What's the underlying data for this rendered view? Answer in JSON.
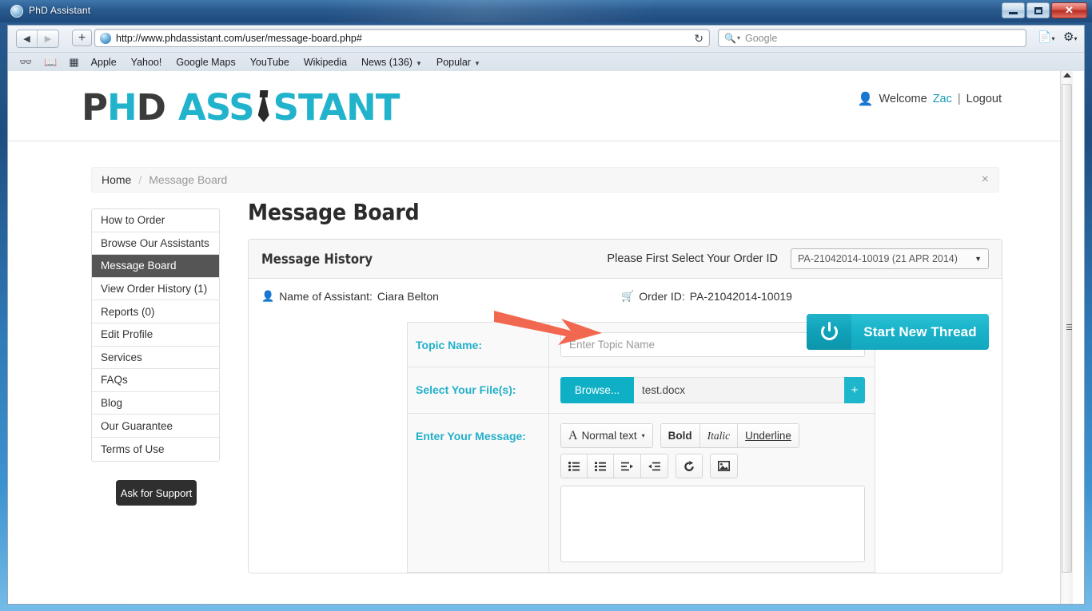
{
  "window": {
    "title": "PhD Assistant",
    "favicon": "globe-icon",
    "minimize": "minimize-icon",
    "maximize": "maximize-icon",
    "close": "✕"
  },
  "browser": {
    "back": "◀",
    "forward": "▶",
    "add_tab": "+",
    "url": "http://www.phdassistant.com/user/message-board.php#",
    "reload": "↻",
    "search_icon": "search-icon",
    "search_placeholder": "Google",
    "page_menu": "page-icon",
    "settings_menu": "gear-icon",
    "bookmarks": [
      {
        "label": "Apple",
        "caret": false
      },
      {
        "label": "Yahoo!",
        "caret": false
      },
      {
        "label": "Google Maps",
        "caret": false
      },
      {
        "label": "YouTube",
        "caret": false
      },
      {
        "label": "Wikipedia",
        "caret": false
      },
      {
        "label": "News (136)",
        "caret": true
      },
      {
        "label": "Popular",
        "caret": true
      }
    ]
  },
  "site_header": {
    "logo": {
      "part1": "PH",
      "tie": "tie-icon",
      "part2": "D",
      "brand1": "ASS",
      "brand2": "STANT"
    },
    "welcome_prefix": "Welcome",
    "user_name": "Zac",
    "separator": "|",
    "logout": "Logout"
  },
  "breadcrumb": {
    "home": "Home",
    "separator": "/",
    "current": "Message Board",
    "close": "×"
  },
  "sidebar": {
    "items": [
      {
        "label": "How to Order",
        "active": false
      },
      {
        "label": "Browse Our Assistants",
        "active": false
      },
      {
        "label": "Message Board",
        "active": true
      },
      {
        "label": "View Order History (1)",
        "active": false
      },
      {
        "label": "Reports (0)",
        "active": false
      },
      {
        "label": "Edit Profile",
        "active": false
      },
      {
        "label": "Services",
        "active": false
      },
      {
        "label": "FAQs",
        "active": false
      },
      {
        "label": "Blog",
        "active": false
      },
      {
        "label": "Our Guarantee",
        "active": false
      },
      {
        "label": "Terms of Use",
        "active": false
      }
    ],
    "support_button": "Ask for Support"
  },
  "main": {
    "page_title": "Message Board",
    "panel": {
      "header_title": "Message History",
      "select_prompt": "Please First Select Your Order ID",
      "order_select_value": "PA-21042014-10019 (21 APR 2014)",
      "order_select_caret": "▼",
      "assistant_label": "Name of Assistant:",
      "assistant_name": "Ciara Belton",
      "order_id_label": "Order ID:",
      "order_id_value": "PA-21042014-10019",
      "new_thread_button": "Start New Thread",
      "new_thread_icon": "power-icon"
    },
    "form": {
      "topic_label": "Topic Name:",
      "topic_placeholder": "Enter Topic Name",
      "file_label": "Select Your File(s):",
      "browse_button": "Browse...",
      "file_name": "test.docx",
      "add_file_button": "+",
      "message_label": "Enter Your Message:",
      "toolbar_row1": [
        {
          "name": "text-style-dropdown",
          "label": "Normal text",
          "icon": "A",
          "caret": "▾"
        },
        {
          "name": "bold-button",
          "label": "Bold"
        },
        {
          "name": "italic-button",
          "label": "Italic"
        },
        {
          "name": "underline-button",
          "label": "Underline"
        }
      ],
      "toolbar_row2": [
        {
          "name": "unordered-list-icon",
          "glyph": "☰"
        },
        {
          "name": "ordered-list-icon",
          "glyph": "☰"
        },
        {
          "name": "indent-right-icon",
          "glyph": "→"
        },
        {
          "name": "indent-left-icon",
          "glyph": "←"
        },
        {
          "name": "redo-icon",
          "glyph": "↻"
        },
        {
          "name": "insert-image-icon",
          "glyph": "▣"
        }
      ],
      "message_value": ""
    }
  },
  "annotation": {
    "arrow_color": "#f2674f",
    "arrow_points_to": "order-id-select"
  }
}
